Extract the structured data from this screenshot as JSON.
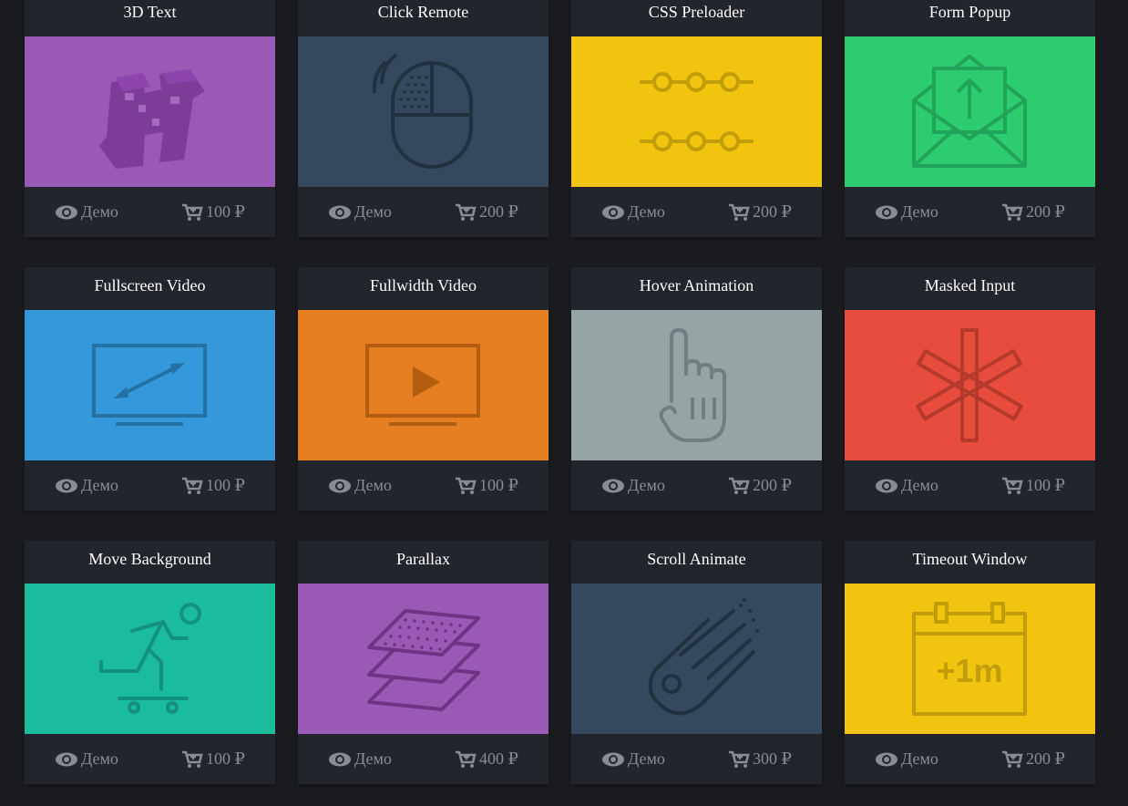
{
  "labels": {
    "demo": "Демо",
    "currency": "₽"
  },
  "cards": [
    {
      "title": "3D Text",
      "price": "100 ₽",
      "color": "#9b59b6",
      "icon": "3d-text-icon"
    },
    {
      "title": "Click Remote",
      "price": "200 ₽",
      "color": "#34495e",
      "icon": "mouse-click-icon"
    },
    {
      "title": "CSS Preloader",
      "price": "200 ₽",
      "color": "#f1c40f",
      "icon": "preloader-dots-icon"
    },
    {
      "title": "Form Popup",
      "price": "200 ₽",
      "color": "#2ecc71",
      "icon": "envelope-upload-icon"
    },
    {
      "title": "Fullscreen Video",
      "price": "100 ₽",
      "color": "#3498db",
      "icon": "monitor-expand-icon"
    },
    {
      "title": "Fullwidth Video",
      "price": "100 ₽",
      "color": "#e67e22",
      "icon": "monitor-play-icon"
    },
    {
      "title": "Hover Animation",
      "price": "200 ₽",
      "color": "#95a5a6",
      "icon": "pointing-hand-icon"
    },
    {
      "title": "Masked Input",
      "price": "100 ₽",
      "color": "#e74c3c",
      "icon": "asterisk-icon"
    },
    {
      "title": "Move Background",
      "price": "100 ₽",
      "color": "#1abc9c",
      "icon": "skateboarder-icon"
    },
    {
      "title": "Parallax",
      "price": "400 ₽",
      "color": "#9b59b6",
      "icon": "layers-icon"
    },
    {
      "title": "Scroll Animate",
      "price": "300 ₽",
      "color": "#34495e",
      "icon": "comet-icon"
    },
    {
      "title": "Timeout Window",
      "price": "200 ₽",
      "color": "#f1c40f",
      "icon": "calendar-plus-icon",
      "icon_text": "+1m"
    }
  ]
}
